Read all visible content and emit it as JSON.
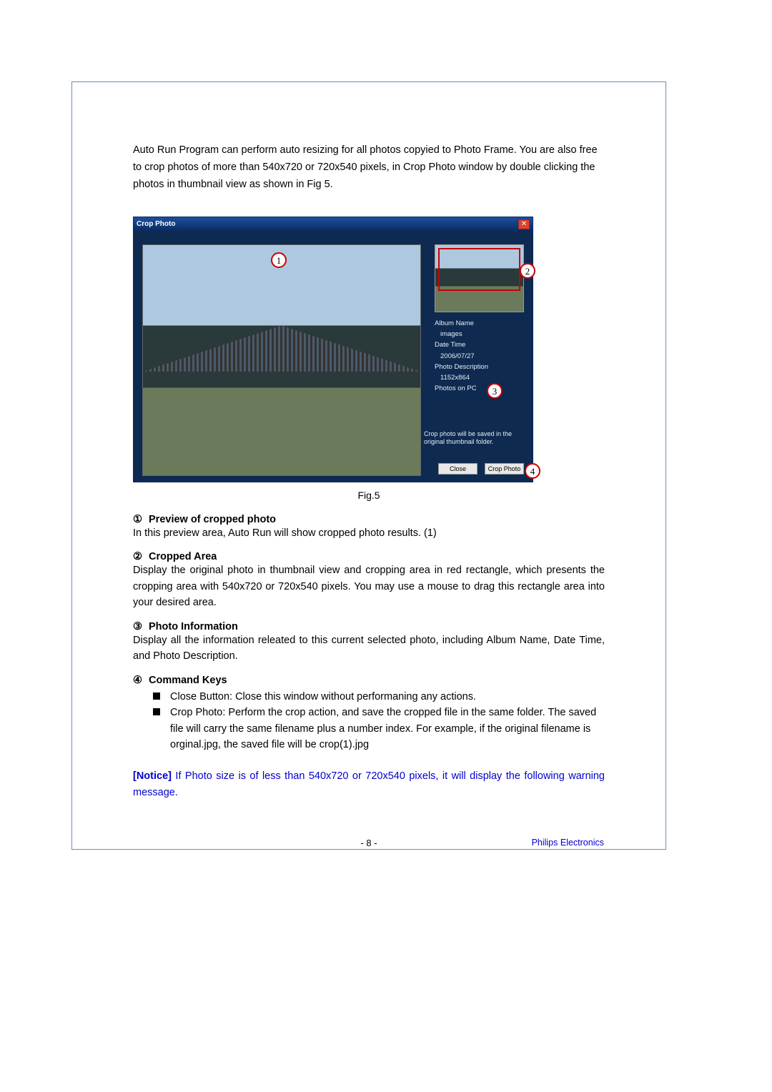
{
  "intro": "Auto Run Program can perform auto resizing for all photos copyied to Photo Frame. You are also free to crop photos of more than 540x720 or 720x540 pixels, in Crop Photo window by double clicking the photos in thumbnail view as shown in Fig 5.",
  "figure": {
    "window_title": "Crop Photo",
    "close_glyph": "✕",
    "info": {
      "album_name_label": "Album Name",
      "album_name_value": "images",
      "date_time_label": "Date Time",
      "date_time_value": "2006/07/27",
      "photo_desc_label": "Photo Description",
      "photo_desc_value": "1152x864",
      "photos_on_pc_label": "Photos on PC"
    },
    "save_note": "Crop photo will be saved in the original thumbnail folder.",
    "buttons": {
      "close": "Close",
      "crop": "Crop Photo"
    },
    "callouts": {
      "c1": "1",
      "c2": "2",
      "c3": "3",
      "c4": "4"
    },
    "caption": "Fig.5"
  },
  "sections": [
    {
      "num": "①",
      "title": "Preview of cropped photo",
      "body": "In this preview area, Auto Run will show cropped photo results. (1)"
    },
    {
      "num": "②",
      "title": "Cropped Area",
      "body": "Display the original photo in thumbnail view and cropping area in red rectangle, which presents the cropping area with 540x720 or 720x540 pixels. You may use a mouse to drag this rectangle area into your desired area."
    },
    {
      "num": "③",
      "title": "Photo Information",
      "body": "Display all the information releated to this current selected photo, including Album Name, Date Time, and Photo Description."
    },
    {
      "num": "④",
      "title": "Command Keys",
      "bullets": [
        "Close Button: Close this window without performaning any actions.",
        "Crop Photo: Perform the crop action, and save the cropped file in the same folder. The saved file will carry the same filename plus a number index. For example, if the original filename is orginal.jpg, the saved file will be crop(1).jpg"
      ]
    }
  ],
  "notice": {
    "label": "[Notice]",
    "text": " If Photo size is of less than 540x720 or 720x540 pixels, it will display the following warning message."
  },
  "footer": {
    "page_number": "- 8 -",
    "brand": "Philips Electronics"
  }
}
